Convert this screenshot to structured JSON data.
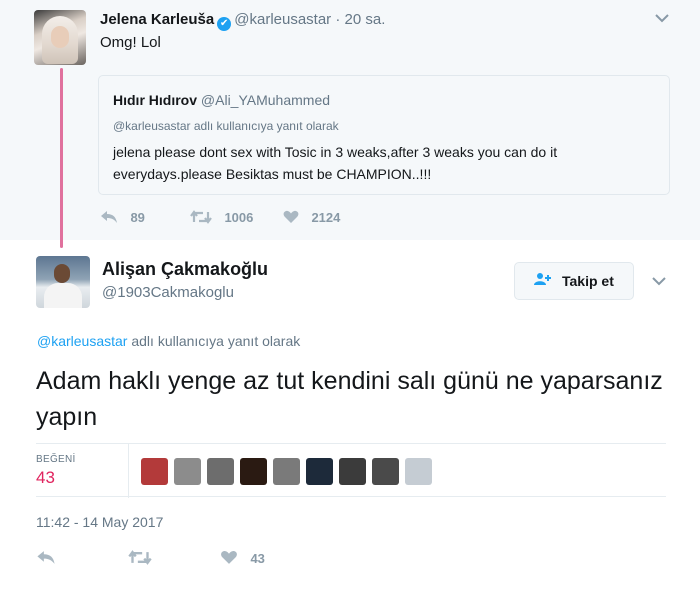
{
  "parent": {
    "name": "Jelena Karleuša",
    "handle": "@karleusastar",
    "dot": "·",
    "time": "20 sa.",
    "text": "Omg! Lol",
    "verified_icon": "✔",
    "quote": {
      "name": "Hıdır Hıdırov",
      "handle": "@Ali_YAMuhammed",
      "reply_to": "@karleusastar adlı kullanıcıya yanıt olarak",
      "text": "jelena please dont sex with Tosic in 3 weaks,after 3 weaks you can do it everydays.please Besiktas must be CHAMPION..!!!"
    },
    "actions": {
      "reply_count": "89",
      "retweet_count": "1006",
      "like_count": "2124"
    }
  },
  "main": {
    "name": "Alişan Çakmakoğlu",
    "handle": "@1903Cakmakoglu",
    "follow_label": "Takip et",
    "reply_mention": "@karleusastar",
    "reply_suffix": " adlı kullanıcıya yanıt olarak",
    "text": "Adam haklı yenge az tut kendini salı günü ne yaparsanız yapın",
    "likes_label": "BEĞENİ",
    "likes_count": "43",
    "timestamp": "11:42 - 14 May 2017",
    "action_like_count": "43"
  },
  "icons": {
    "reply": "reply-arrow-icon",
    "retweet": "retweet-icon",
    "like": "heart-icon",
    "follow": "add-user-icon",
    "chevron": "chevron-down-icon"
  },
  "colors": {
    "accent": "#1da1f2",
    "like": "#e0245e",
    "thread_line": "#e0719d",
    "muted": "#657786"
  },
  "likers": [
    {
      "name": "liker-1",
      "color": "#b33a3a"
    },
    {
      "name": "liker-2",
      "color": "#8c8c8c"
    },
    {
      "name": "liker-3",
      "color": "#6d6d6d"
    },
    {
      "name": "liker-4",
      "color": "#2a1a12"
    },
    {
      "name": "liker-5",
      "color": "#7a7a7a"
    },
    {
      "name": "liker-6",
      "color": "#1d2a3a"
    },
    {
      "name": "liker-7",
      "color": "#3b3b3b"
    },
    {
      "name": "liker-8",
      "color": "#4a4a4a"
    },
    {
      "name": "liker-9",
      "color": "#c5ccd3"
    }
  ]
}
